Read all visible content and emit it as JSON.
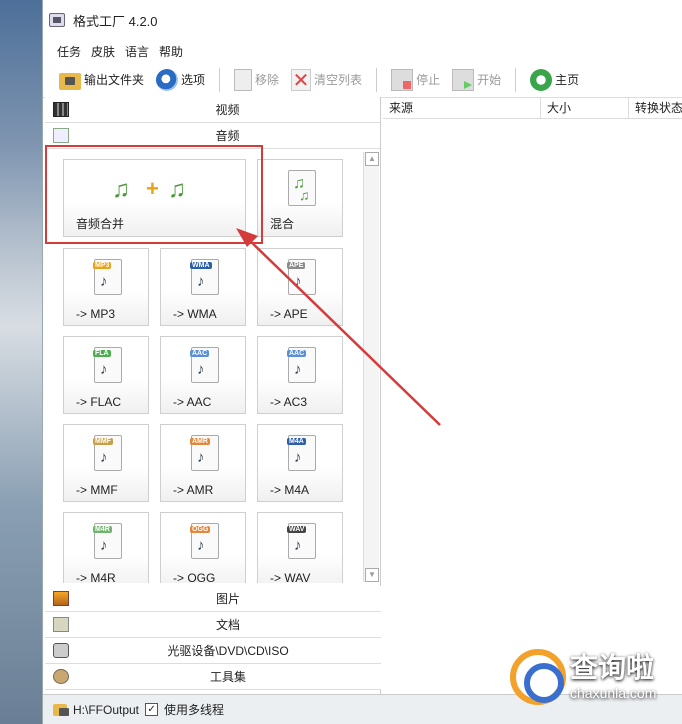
{
  "window": {
    "title": "格式工厂 4.2.0"
  },
  "menu": [
    "任务",
    "皮肤",
    "语言",
    "帮助"
  ],
  "toolbar": {
    "output_folder": "输出文件夹",
    "options": "选项",
    "remove": "移除",
    "clear_list": "清空列表",
    "stop": "停止",
    "start": "开始",
    "home": "主页"
  },
  "categories": {
    "video": "视频",
    "audio": "音频",
    "picture": "图片",
    "document": "文档",
    "disc": "光驱设备\\DVD\\CD\\ISO",
    "tools": "工具集"
  },
  "audio_tiles": [
    {
      "label": "音频合并"
    },
    {
      "label": "混合"
    },
    {
      "label": "-> MP3",
      "tag": "MP3",
      "tag_color": "#e8a317"
    },
    {
      "label": "-> WMA",
      "tag": "WMA",
      "tag_color": "#2d5fa8"
    },
    {
      "label": "-> APE",
      "tag": "APE",
      "tag_color": "#8a8a8a"
    },
    {
      "label": "-> FLAC",
      "tag": "FLA",
      "tag_color": "#4caf50"
    },
    {
      "label": "-> AAC",
      "tag": "AAC",
      "tag_color": "#5b8fd6"
    },
    {
      "label": "-> AC3",
      "tag": "AAC",
      "tag_color": "#5b8fd6"
    },
    {
      "label": "-> MMF",
      "tag": "MMF",
      "tag_color": "#c9a04a"
    },
    {
      "label": "-> AMR",
      "tag": "AMR",
      "tag_color": "#e3873a"
    },
    {
      "label": "-> M4A",
      "tag": "M4A",
      "tag_color": "#2d5fa8"
    },
    {
      "label": "-> M4R",
      "tag": "M4R",
      "tag_color": "#6fb56f"
    },
    {
      "label": "-> OGG",
      "tag": "OGG",
      "tag_color": "#e3873a"
    },
    {
      "label": "-> WAV",
      "tag": "WAV",
      "tag_color": "#444444"
    }
  ],
  "list_columns": [
    "来源",
    "大小",
    "转换状态"
  ],
  "statusbar": {
    "output_path": "H:\\FFOutput",
    "multithread": "使用多线程",
    "multithread_checked": "✓"
  },
  "watermark": {
    "cn": "查询啦",
    "en": "chaxunla.com"
  },
  "colors": {
    "highlight": "#d43c3c"
  }
}
